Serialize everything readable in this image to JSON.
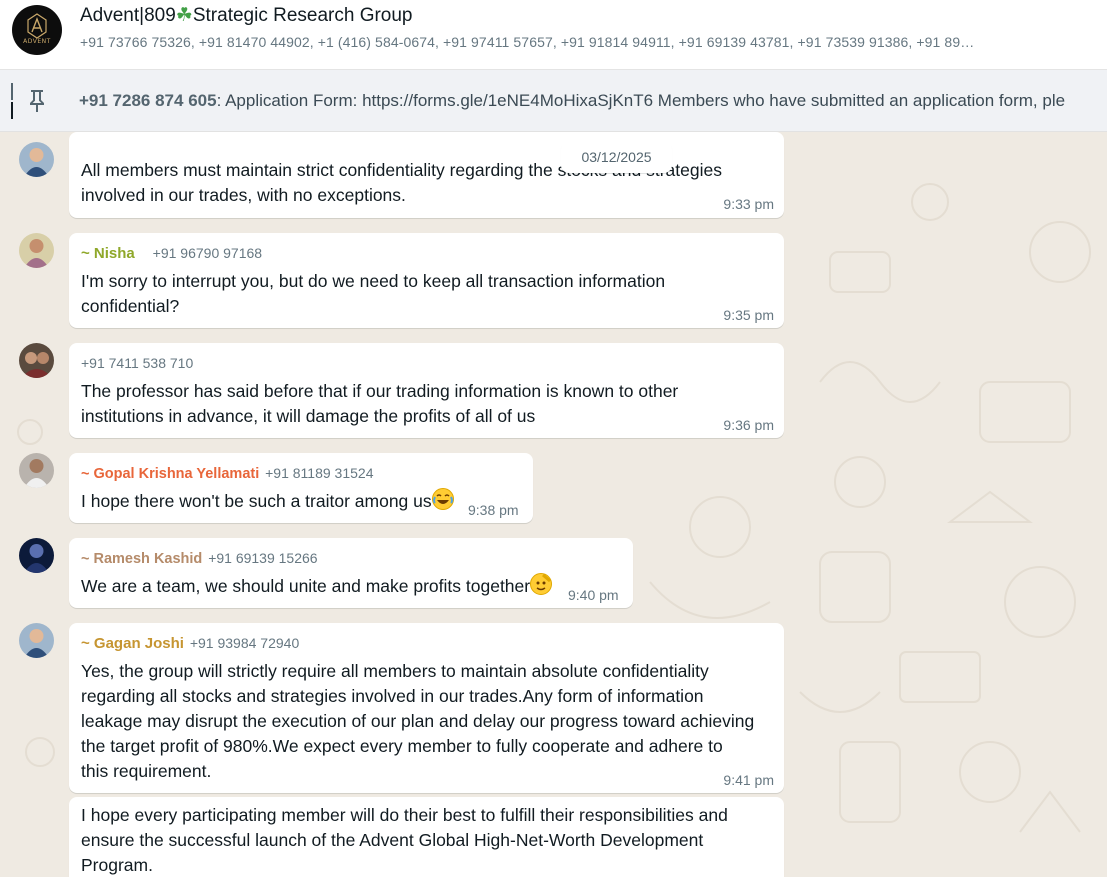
{
  "header": {
    "group_name_part1": "Advent|809",
    "group_name_icon": "☘",
    "group_name_part2": "Strategic Research Group",
    "members": "+91 73766 75326, +91 81470 44902, +1 (416) 584-0674, +91 97411 57657, +91 91814 94911, +91 69139 43781, +91 73539 91386, +91 89…",
    "avatar_logo_text": "ADVENT",
    "icon": "shamrock-icon"
  },
  "pinned": {
    "sender": "+91 7286 874 605",
    "text": ": Application Form: https://forms.gle/1eNE4MoHixaSjKnT6 Members who have submitted an application form, ple",
    "icon": "pin-icon"
  },
  "date_chip": "03/12/2025",
  "messages": [
    {
      "lines": [
        "All members must maintain strict confidentiality regarding the stocks and strategies",
        "involved in our trades, with no exceptions."
      ],
      "time": "9:33 pm"
    },
    {
      "sender": "~ Nisha",
      "sender_color": "#8fa82a",
      "phone": "+91 96790 97168",
      "lines": [
        "I'm sorry to interrupt you, but do we need to keep all transaction information",
        "confidential?"
      ],
      "time": "9:35 pm"
    },
    {
      "phone": "+91 7411 538 710",
      "lines": [
        "The professor has said before that if our trading information is known to other",
        "institutions in advance, it will damage the profits of all of us"
      ],
      "time": "9:36 pm"
    },
    {
      "sender": "~ Gopal Krishna Yellamati",
      "sender_color": "#e8663a",
      "phone": "+91 81189 31524",
      "lines": [
        "I hope there won't be such a traitor among us"
      ],
      "emoji": "face-with-tears-of-joy",
      "time": "9:38 pm"
    },
    {
      "sender": "~ Ramesh Kashid",
      "sender_color": "#b58b6a",
      "phone": "+91 69139 15266",
      "lines": [
        "We are a team, we should unite and make profits together"
      ],
      "emoji": "saluting-face",
      "time": "9:40 pm"
    },
    {
      "sender": "~ Gagan Joshi",
      "sender_color": "#c69531",
      "phone": "+91 93984 72940",
      "lines": [
        "Yes, the group will strictly require all members to maintain absolute confidentiality",
        "regarding all stocks and strategies involved in our trades.Any form of information",
        "leakage may disrupt the execution of our plan and delay our progress toward achieving",
        "the target profit of 980%.We expect every member to fully cooperate and adhere to",
        "this requirement."
      ],
      "time": "9:41 pm"
    },
    {
      "lines": [
        "I hope every participating member will do their best to fulfill their responsibilities and",
        "ensure the successful launch of the Advent Global High-Net-Worth Development",
        "Program."
      ]
    }
  ],
  "colors": {
    "chat_background": "#efeae2",
    "bubble": "#ffffff",
    "timestamp": "#667781"
  }
}
